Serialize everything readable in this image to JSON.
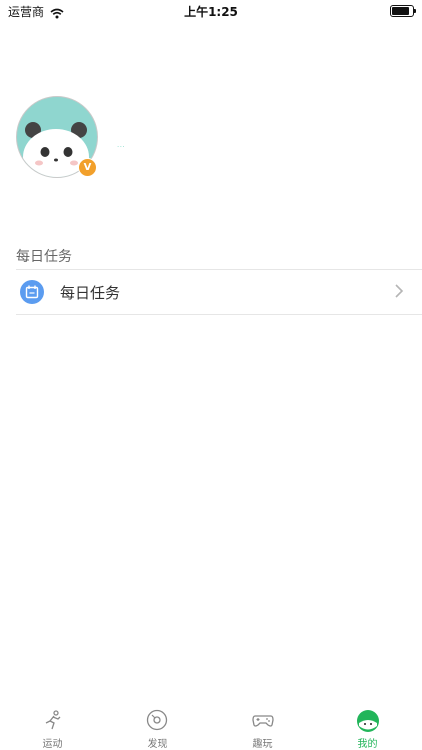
{
  "status_bar": {
    "carrier": "运营商",
    "time": "上午1:25"
  },
  "profile": {
    "nickname": "···",
    "badge": "V"
  },
  "section": {
    "title": "每日任务"
  },
  "tasks": [
    {
      "label": "每日任务"
    }
  ],
  "tabs": [
    {
      "label": "运动",
      "icon": "running-icon",
      "active": false
    },
    {
      "label": "发现",
      "icon": "discover-icon",
      "active": false
    },
    {
      "label": "趣玩",
      "icon": "gamepad-icon",
      "active": false
    },
    {
      "label": "我的",
      "icon": "profile-face-icon",
      "active": true
    }
  ],
  "colors": {
    "accent": "#22b55a",
    "task_icon": "#5b9cf0",
    "badge": "#f2a02b",
    "avatar_bg": "#8fd6cf"
  }
}
